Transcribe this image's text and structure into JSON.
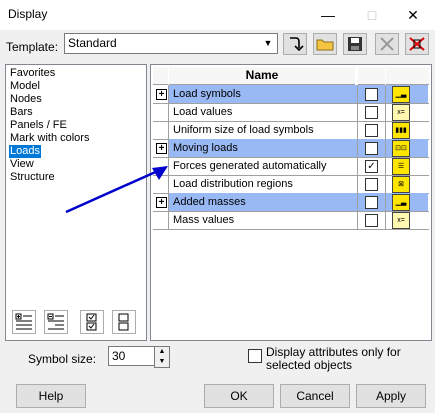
{
  "window": {
    "title": "Display",
    "minimize_glyph": "—",
    "maximize_glyph": "□",
    "close_glyph": "✕"
  },
  "template": {
    "label": "Template:",
    "value": "Standard"
  },
  "toolbar_icons": [
    "apply-template-icon",
    "open-folder-icon",
    "save-icon",
    "delete-icon",
    "clear-icon"
  ],
  "categories": {
    "items": [
      "Favorites",
      "Model",
      "Nodes",
      "Bars",
      "Panels / FE",
      "Mark with colors",
      "Loads",
      "View",
      "Structure"
    ],
    "selected": "Loads"
  },
  "grid": {
    "header_name": "Name",
    "rows": [
      {
        "label": "Load symbols",
        "group": true,
        "checked": false,
        "icon": "load-symbols-icon"
      },
      {
        "label": "Load values",
        "group": false,
        "checked": false,
        "icon": "load-values-icon"
      },
      {
        "label": "Uniform size of load symbols",
        "group": false,
        "checked": false,
        "icon": "uniform-size-icon"
      },
      {
        "label": "Moving loads",
        "group": true,
        "checked": false,
        "icon": "moving-loads-icon"
      },
      {
        "label": "Forces generated automatically",
        "group": false,
        "checked": true,
        "icon": "forces-generated-icon"
      },
      {
        "label": "Load distribution regions",
        "group": false,
        "checked": false,
        "icon": "load-distribution-icon"
      },
      {
        "label": "Added masses",
        "group": true,
        "checked": false,
        "icon": "added-masses-icon"
      },
      {
        "label": "Mass values",
        "group": false,
        "checked": false,
        "icon": "mass-values-icon"
      }
    ]
  },
  "symbol_size": {
    "label": "Symbol size:",
    "value": "30"
  },
  "selected_only": {
    "label": "Display attributes only for selected objects",
    "checked": false
  },
  "buttons": {
    "help": "Help",
    "ok": "OK",
    "cancel": "Cancel",
    "apply": "Apply"
  },
  "colors": {
    "group_row": "#99b9f5",
    "selection": "#0078d7",
    "annotation_arrow": "#0000cc",
    "icon_fill": "#ffe600"
  }
}
